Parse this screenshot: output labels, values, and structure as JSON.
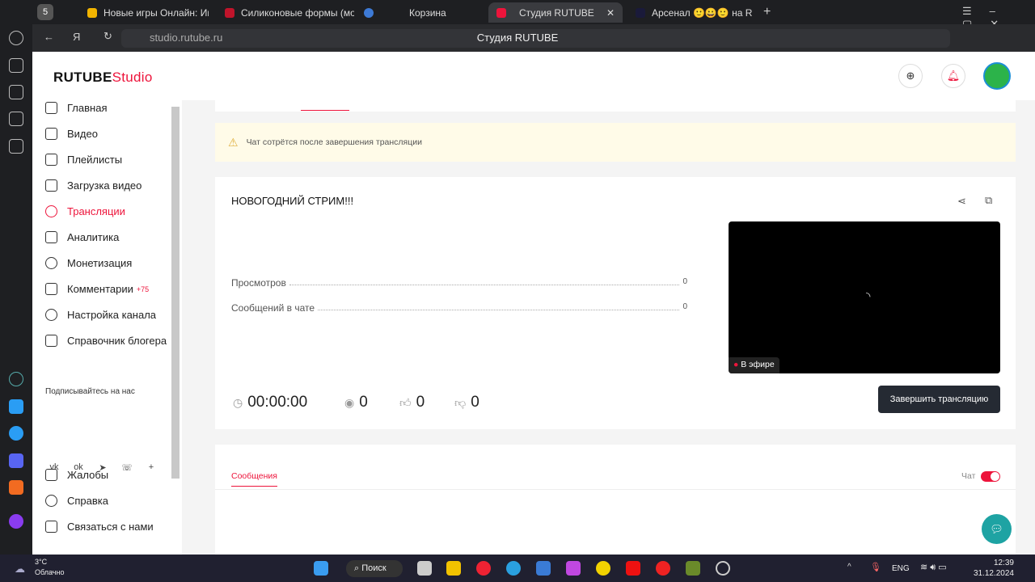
{
  "browser": {
    "tab_count": "5",
    "tabs": [
      {
        "label": "Новые игры Онлайн: Игр",
        "color": "#f2b400"
      },
      {
        "label": "Силиконовые формы (мо",
        "color": "#c0142b"
      },
      {
        "label": "Корзина",
        "color": "#3d7ad6"
      },
      {
        "label": "Студия RUTUBE",
        "color": "#ed143b",
        "active": true
      },
      {
        "label": "Арсенал 🙂😀🙂 на R",
        "color": "#1a1a3a"
      }
    ],
    "url": "studio.rutube.ru",
    "page_title": "Студия RUTUBE"
  },
  "header": {
    "logo_main": "RUTUBE",
    "logo_sub": "Studio"
  },
  "sidebar": {
    "items": [
      {
        "label": "Главная",
        "icon": "home-icon"
      },
      {
        "label": "Видео",
        "icon": "video-icon"
      },
      {
        "label": "Плейлисты",
        "icon": "list-icon"
      },
      {
        "label": "Загрузка видео",
        "icon": "upload-icon"
      },
      {
        "label": "Трансляции",
        "icon": "broadcast-icon",
        "active": true
      },
      {
        "label": "Аналитика",
        "icon": "analytics-icon"
      },
      {
        "label": "Монетизация",
        "icon": "ruble-icon"
      },
      {
        "label": "Комментарии",
        "icon": "comment-icon",
        "badge": "+75"
      },
      {
        "label": "Настройка канала",
        "icon": "gear-icon"
      },
      {
        "label": "Справочник блогера",
        "icon": "info-icon"
      }
    ],
    "subscribe_label": "Подписывайтесь на нас",
    "socials": [
      "vk",
      "ok",
      "telegram",
      "viber",
      "plus"
    ],
    "bottom": [
      {
        "label": "Жалобы",
        "icon": "flag-icon"
      },
      {
        "label": "Справка",
        "icon": "help-icon"
      },
      {
        "label": "Связаться с нами",
        "icon": "mail-icon"
      }
    ]
  },
  "main": {
    "warning": "Чат сотрётся после завершения трансляции",
    "stream_title": "НОВОГОДНИЙ СТРИМ!!!",
    "stats": [
      {
        "label": "Просмотров",
        "value": "0"
      },
      {
        "label": "Сообщений в чате",
        "value": "0"
      }
    ],
    "live_label": "В эфире",
    "timer": "00:00:00",
    "viewers": "0",
    "likes": "0",
    "dislikes": "0",
    "end_button": "Завершить трансляцию",
    "messages_tab": "Сообщения",
    "chat_label": "Чат",
    "chat_enabled": true,
    "accent": "#ed143b"
  },
  "taskbar": {
    "weather_temp": "3°C",
    "weather_desc": "Облачно",
    "search": "Поиск",
    "lang": "ENG",
    "time": "12:39",
    "date": "31.12.2024"
  }
}
